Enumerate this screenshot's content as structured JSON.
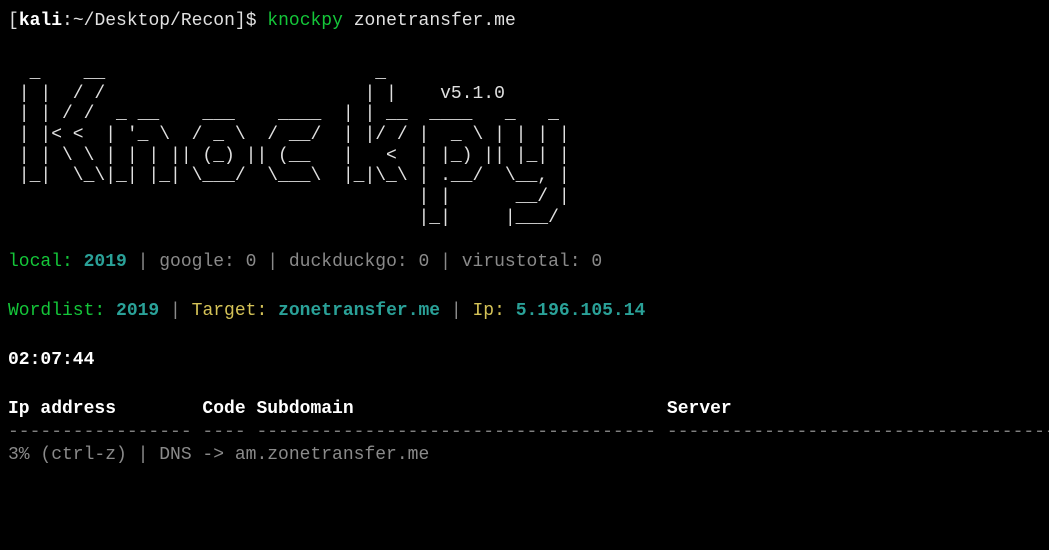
{
  "prompt": {
    "open_bracket": "[",
    "host": "kali",
    "colon": ":",
    "path": "~/Desktop/Recon",
    "close_bracket": "]",
    "dollar": "$ ",
    "command": "knockpy",
    "arg": " zonetransfer.me"
  },
  "ascii": {
    "l1": "  _    __                         _",
    "l2": " | |  / /                        | |    v5.1.0",
    "l3": " | | / /  _ __    ___    ____  | | __  ____   _   _",
    "l4": " | |< <  | '_ \\  / _ \\  / __/  | |/ / |  _ \\ | | | |",
    "l5": " | | \\ \\ | | | || (_) || (__   |   <  | |_) || |_| |",
    "l6": " |_|  \\_\\|_| |_| \\___/  \\___\\  |_|\\_\\ | .__/  \\__, |",
    "l7": "                                      | |      __/ |",
    "l8": "                                      |_|     |___/"
  },
  "sources": {
    "local_label": "local:",
    "local_value": " 2019",
    "sep1": " | ",
    "google_label": "google: ",
    "google_value": "0",
    "sep2": " | ",
    "ddg_label": "duckduckgo: ",
    "ddg_value": "0",
    "sep3": " | ",
    "vt_label": "virustotal: ",
    "vt_value": "0"
  },
  "info": {
    "wordlist_label": "Wordlist:",
    "wordlist_value": " 2019",
    "sep1": " | ",
    "target_label": "Target:",
    "target_value": " zonetransfer.me",
    "sep2": " | ",
    "ip_label": "Ip:",
    "ip_value": " 5.196.105.14"
  },
  "timestamp": "02:07:44",
  "table": {
    "header": "Ip address        Code Subdomain                             Server",
    "sep": "----------------- ---- ------------------------------------- ------------------------------------"
  },
  "progress": "3% (ctrl-z) | DNS -> am.zonetransfer.me"
}
